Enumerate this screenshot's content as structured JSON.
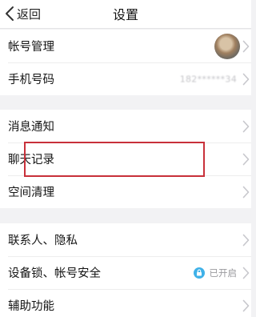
{
  "navbar": {
    "back_label": "返回",
    "title": "设置"
  },
  "groups": [
    {
      "items": [
        {
          "label": "帐号管理",
          "accessory": "avatar"
        },
        {
          "label": "手机号码",
          "value": "182******34"
        }
      ]
    },
    {
      "items": [
        {
          "label": "消息通知"
        },
        {
          "label": "聊天记录",
          "highlighted": true
        },
        {
          "label": "空间清理"
        }
      ]
    },
    {
      "items": [
        {
          "label": "联系人、隐私"
        },
        {
          "label": "设备锁、帐号安全",
          "status": "已开启",
          "status_icon": "lock-icon"
        },
        {
          "label": "辅助功能"
        }
      ]
    }
  ],
  "colors": {
    "background": "#f2f2f4",
    "row_background": "#ffffff",
    "highlight_border": "#c8303a",
    "lock_badge": "#3fb1e8",
    "secondary_text": "#9a9a9e"
  }
}
